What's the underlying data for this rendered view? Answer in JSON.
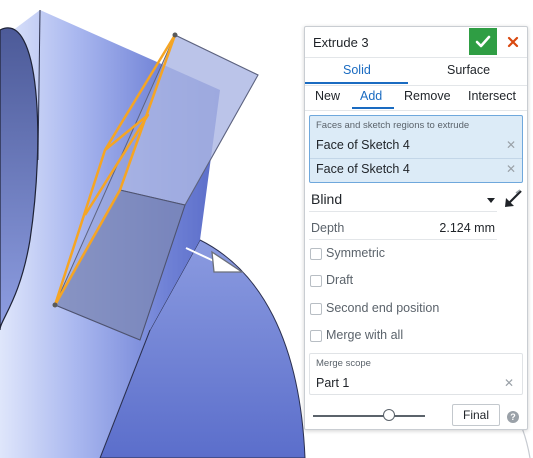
{
  "dialog": {
    "title": "Extrude 3",
    "ok_icon": "checkmark-icon",
    "cancel_icon": "close-icon",
    "body_types": [
      {
        "label": "Solid",
        "selected": true
      },
      {
        "label": "Surface",
        "selected": false
      }
    ],
    "operations": [
      {
        "label": "New",
        "selected": false
      },
      {
        "label": "Add",
        "selected": true
      },
      {
        "label": "Remove",
        "selected": false
      },
      {
        "label": "Intersect",
        "selected": false
      }
    ],
    "selection": {
      "label": "Faces and sketch regions to extrude",
      "items": [
        "Face of Sketch 4",
        "Face of Sketch 4"
      ]
    },
    "end_type": "Blind",
    "flip_icon": "flip-direction-icon",
    "depth": {
      "label": "Depth",
      "value": "2.124 mm"
    },
    "checkboxes": [
      {
        "label": "Symmetric",
        "checked": false
      },
      {
        "label": "Draft",
        "checked": false
      },
      {
        "label": "Second end position",
        "checked": false
      },
      {
        "label": "Merge with all",
        "checked": false
      }
    ],
    "merge_scope": {
      "label": "Merge scope",
      "value": "Part 1"
    },
    "history_slider": {
      "value": 0.7
    },
    "final_label": "Final",
    "help_label": "?"
  },
  "colors": {
    "accent": "#1a6bc1",
    "ok_green": "#2f9e44",
    "cancel_red": "#d9480f",
    "sketch_orange": "#f5a524",
    "body_blue": "#7d8fd9"
  }
}
